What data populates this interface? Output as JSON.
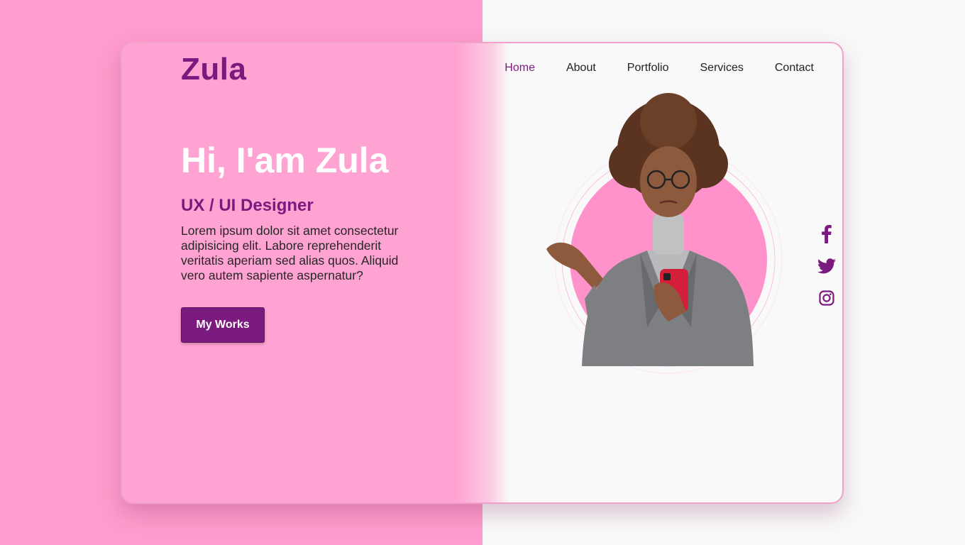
{
  "brand": {
    "logo": "Zula"
  },
  "nav": {
    "items": [
      {
        "label": "Home",
        "active": true
      },
      {
        "label": "About"
      },
      {
        "label": "Portfolio"
      },
      {
        "label": "Services"
      },
      {
        "label": "Contact"
      }
    ]
  },
  "hero": {
    "title": "Hi, I'am Zula",
    "role": "UX / UI Designer",
    "description": "Lorem ipsum dolor sit amet consectetur adipisicing elit. Labore reprehenderit veritatis aperiam sed alias quos. Aliquid vero autem sapiente aspernatur?",
    "cta_label": "My Works"
  },
  "social": [
    {
      "icon": "facebook-icon"
    },
    {
      "icon": "twitter-icon"
    },
    {
      "icon": "instagram-icon"
    }
  ],
  "colors": {
    "accent": "#7b1a7e",
    "pink_bg": "#ff9ccd",
    "card_pink": "#ffa3d2",
    "light_bg": "#f9f9f9"
  }
}
